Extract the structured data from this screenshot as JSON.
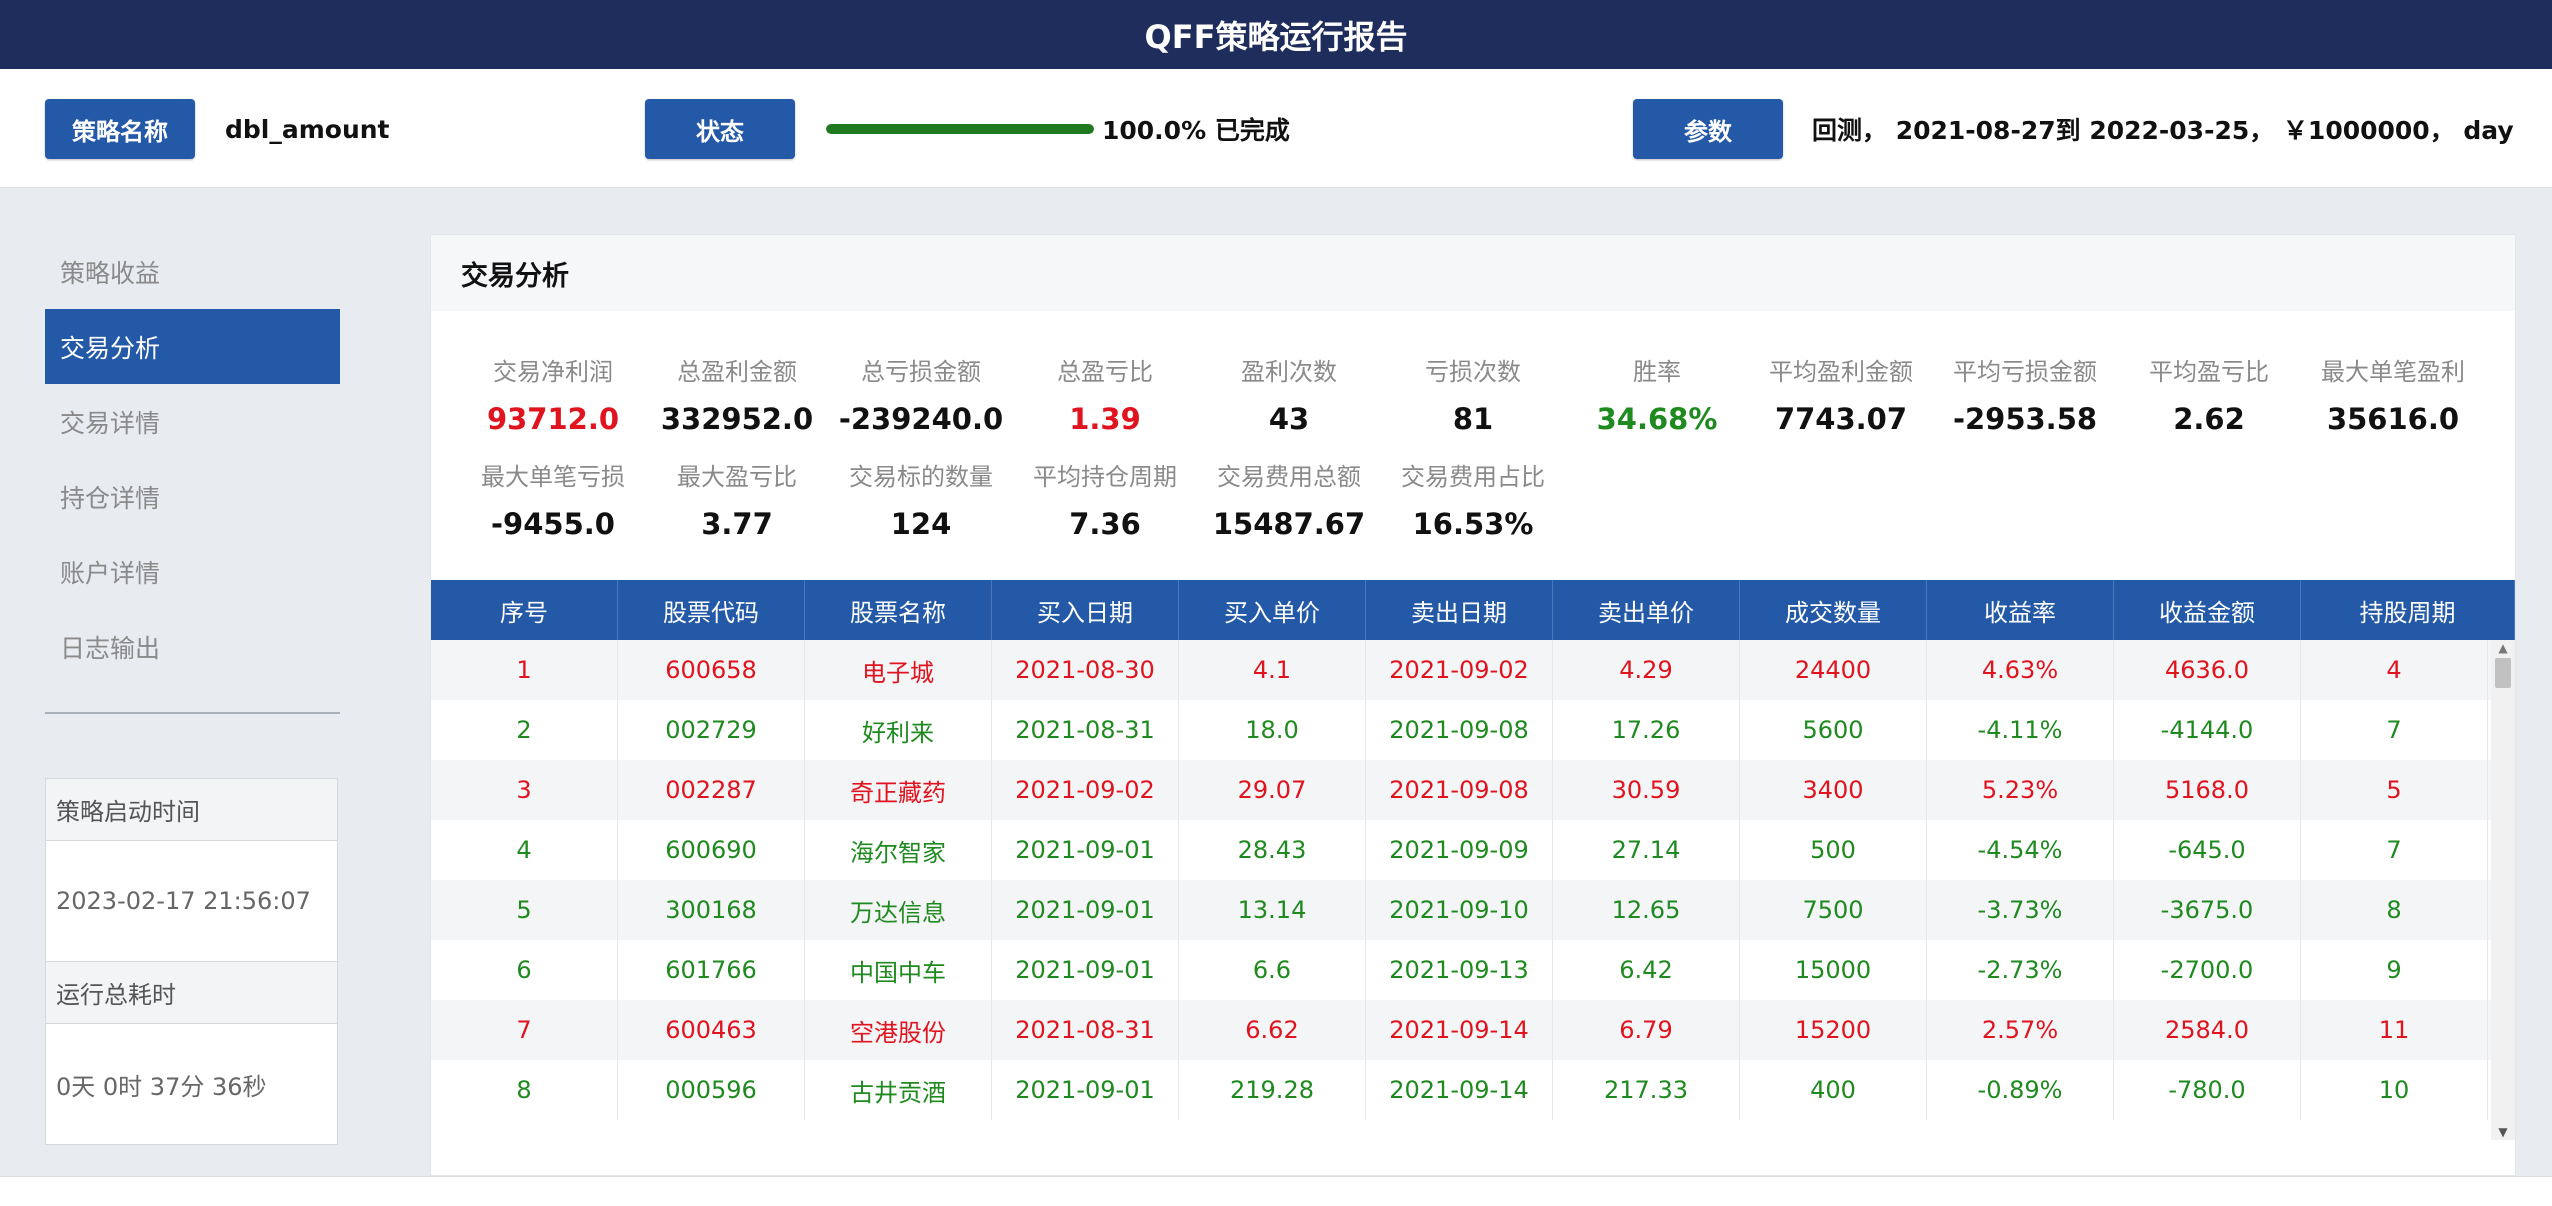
{
  "title": "QFF策略运行报告",
  "header": {
    "strategy_label": "策略名称",
    "strategy_value": "dbl_amount",
    "status_label": "状态",
    "progress": 1.0,
    "status_text": "100.0% 已完成",
    "params_label": "参数",
    "params_text": "回测， 2021-08-27到 2022-03-25， ￥1000000， day"
  },
  "sidebar": {
    "items": [
      {
        "label": "策略收益",
        "active": false
      },
      {
        "label": "交易分析",
        "active": true
      },
      {
        "label": "交易详情",
        "active": false
      },
      {
        "label": "持仓详情",
        "active": false
      },
      {
        "label": "账户详情",
        "active": false
      },
      {
        "label": "日志输出",
        "active": false
      }
    ],
    "start_time_label": "策略启动时间",
    "start_time_value": "2023-02-17 21:56:07",
    "duration_label": "运行总耗时",
    "duration_value": "0天 0时 37分 36秒"
  },
  "panel": {
    "title": "交易分析",
    "stats": [
      {
        "label": "交易净利润",
        "value": "93712.0",
        "color": "red"
      },
      {
        "label": "总盈利金额",
        "value": "332952.0",
        "color": "black"
      },
      {
        "label": "总亏损金额",
        "value": "-239240.0",
        "color": "black"
      },
      {
        "label": "总盈亏比",
        "value": "1.39",
        "color": "red"
      },
      {
        "label": "盈利次数",
        "value": "43",
        "color": "black"
      },
      {
        "label": "亏损次数",
        "value": "81",
        "color": "black"
      },
      {
        "label": "胜率",
        "value": "34.68%",
        "color": "green"
      },
      {
        "label": "平均盈利金额",
        "value": "7743.07",
        "color": "black"
      },
      {
        "label": "平均亏损金额",
        "value": "-2953.58",
        "color": "black"
      },
      {
        "label": "平均盈亏比",
        "value": "2.62",
        "color": "black"
      },
      {
        "label": "最大单笔盈利",
        "value": "35616.0",
        "color": "black"
      },
      {
        "label": "最大单笔亏损",
        "value": "-9455.0",
        "color": "black"
      },
      {
        "label": "最大盈亏比",
        "value": "3.77",
        "color": "black"
      },
      {
        "label": "交易标的数量",
        "value": "124",
        "color": "black"
      },
      {
        "label": "平均持仓周期",
        "value": "7.36",
        "color": "black"
      },
      {
        "label": "交易费用总额",
        "value": "15487.67",
        "color": "black"
      },
      {
        "label": "交易费用占比",
        "value": "16.53%",
        "color": "black"
      }
    ]
  },
  "table": {
    "columns": [
      "序号",
      "股票代码",
      "股票名称",
      "买入日期",
      "买入单价",
      "卖出日期",
      "卖出单价",
      "成交数量",
      "收益率",
      "收益金额",
      "持股周期"
    ],
    "rows": [
      {
        "dir": "up",
        "cells": [
          "1",
          "600658",
          "电子城",
          "2021-08-30",
          "4.1",
          "2021-09-02",
          "4.29",
          "24400",
          "4.63%",
          "4636.0",
          "4"
        ]
      },
      {
        "dir": "down",
        "cells": [
          "2",
          "002729",
          "好利来",
          "2021-08-31",
          "18.0",
          "2021-09-08",
          "17.26",
          "5600",
          "-4.11%",
          "-4144.0",
          "7"
        ]
      },
      {
        "dir": "up",
        "cells": [
          "3",
          "002287",
          "奇正藏药",
          "2021-09-02",
          "29.07",
          "2021-09-08",
          "30.59",
          "3400",
          "5.23%",
          "5168.0",
          "5"
        ]
      },
      {
        "dir": "down",
        "cells": [
          "4",
          "600690",
          "海尔智家",
          "2021-09-01",
          "28.43",
          "2021-09-09",
          "27.14",
          "500",
          "-4.54%",
          "-645.0",
          "7"
        ]
      },
      {
        "dir": "down",
        "cells": [
          "5",
          "300168",
          "万达信息",
          "2021-09-01",
          "13.14",
          "2021-09-10",
          "12.65",
          "7500",
          "-3.73%",
          "-3675.0",
          "8"
        ]
      },
      {
        "dir": "down",
        "cells": [
          "6",
          "601766",
          "中国中车",
          "2021-09-01",
          "6.6",
          "2021-09-13",
          "6.42",
          "15000",
          "-2.73%",
          "-2700.0",
          "9"
        ]
      },
      {
        "dir": "up",
        "cells": [
          "7",
          "600463",
          "空港股份",
          "2021-08-31",
          "6.62",
          "2021-09-14",
          "6.79",
          "15200",
          "2.57%",
          "2584.0",
          "11"
        ]
      },
      {
        "dir": "down",
        "cells": [
          "8",
          "000596",
          "古井贡酒",
          "2021-09-01",
          "219.28",
          "2021-09-14",
          "217.33",
          "400",
          "-0.89%",
          "-780.0",
          "10"
        ]
      }
    ]
  }
}
